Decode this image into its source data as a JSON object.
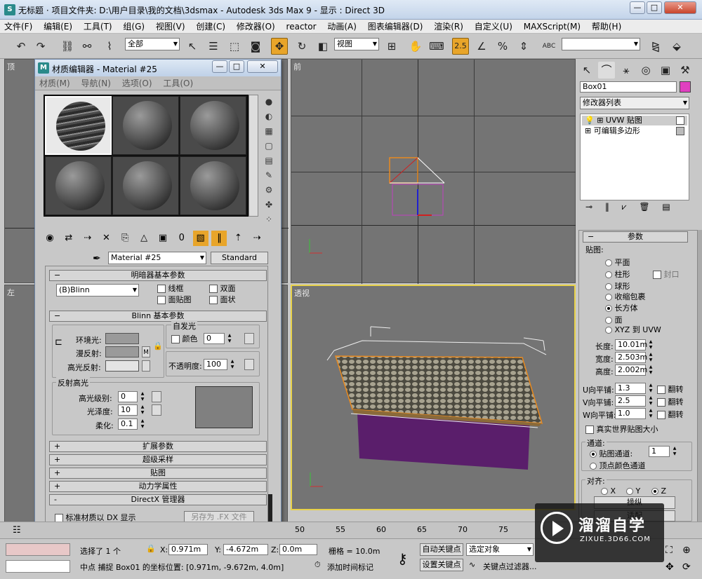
{
  "window": {
    "title": "无标题   · 项目文件夹: D:\\用户目录\\我的文档\\3dsmax    - Autodesk 3ds Max 9      - 显示 : Direct 3D",
    "minimize": "—",
    "maximize": "□",
    "close": "✕"
  },
  "menu": [
    "文件(F)",
    "编辑(E)",
    "工具(T)",
    "组(G)",
    "视图(V)",
    "创建(C)",
    "修改器(O)",
    "reactor",
    "动画(A)",
    "图表编辑器(D)",
    "渲染(R)",
    "自定义(U)",
    "MAXScript(M)",
    "帮助(H)"
  ],
  "toolbar": {
    "selection_filter": "全部",
    "ref_coord": "视图",
    "snap_value": "2.5",
    "abc_label": "ABC"
  },
  "viewports": {
    "top": "顶",
    "front": "前",
    "left": "左",
    "perspective": "透视"
  },
  "material_editor": {
    "title": "材质编辑器 - Material #25",
    "menu": [
      "材质(M)",
      "导航(N)",
      "选项(O)",
      "工具(O)"
    ],
    "material_name": "Material #25",
    "material_type": "Standard",
    "shader_rollout": {
      "title": "明暗器基本参数",
      "shader": "(B)Blinn",
      "wire": "线框",
      "two_sided": "双面",
      "face_map": "面贴图",
      "faceted": "面状"
    },
    "blinn_rollout": {
      "title": "Blinn 基本参数",
      "ambient": "环境光:",
      "diffuse": "漫反射:",
      "specular": "高光反射:",
      "self_illum": "自发光",
      "color": "颜色",
      "self_illum_value": "0",
      "opacity": "不透明度:",
      "opacity_value": "100",
      "lock_m": "M",
      "spec_highlights": "反射高光",
      "spec_level": "高光级别:",
      "spec_level_value": "0",
      "glossiness": "光泽度:",
      "glossiness_value": "10",
      "soften": "柔化:",
      "soften_value": "0.1"
    },
    "rollouts": [
      {
        "sign": "+",
        "title": "扩展参数"
      },
      {
        "sign": "+",
        "title": "超级采样"
      },
      {
        "sign": "+",
        "title": "贴图"
      },
      {
        "sign": "+",
        "title": "动力学属性"
      },
      {
        "sign": "-",
        "title": "DirectX 管理器"
      }
    ],
    "dx_checkbox": "标准材质以 DX 显示",
    "save_fx": "另存为 .FX 文件"
  },
  "command_panel": {
    "object_name": "Box01",
    "modifier_list": "修改器列表",
    "stack": [
      {
        "label": "UVW 贴图",
        "sign": "+"
      },
      {
        "label": "可编辑多边形",
        "sign": "+"
      }
    ],
    "params_title": "参数",
    "mapping_label": "贴图:",
    "mapping_types": [
      "平面",
      "柱形",
      "球形",
      "收缩包裹",
      "长方体",
      "面",
      "XYZ 到 UVW"
    ],
    "selected_mapping": "长方体",
    "cap": "封口",
    "length_label": "长度:",
    "length": "10.01m",
    "width_label": "宽度:",
    "width": "2.503m",
    "height_label": "高度:",
    "height": "2.002m",
    "u_tile_label": "U向平铺:",
    "u_tile": "1.3",
    "v_tile_label": "V向平铺:",
    "v_tile": "2.5",
    "w_tile_label": "W向平铺:",
    "w_tile": "1.0",
    "flip": "翻转",
    "real_world": "真实世界贴图大小",
    "channel_title": "通道:",
    "map_channel": "贴图通道:",
    "map_channel_value": "1",
    "vertex_color": "顶点颜色通道",
    "align_title": "对齐:",
    "axes": [
      "X",
      "Y",
      "Z"
    ],
    "selected_axis": "Z",
    "manip": "操纵",
    "fit": "适配"
  },
  "timeline": {
    "ticks": [
      "50",
      "55",
      "60",
      "65",
      "70",
      "75"
    ]
  },
  "status": {
    "selected": "选择了 1 个",
    "x_label": "X:",
    "x": "0.971m",
    "y_label": "Y:",
    "y": "-4.672m",
    "z_label": "Z:",
    "z": "0.0m",
    "grid": "栅格 = 10.0m",
    "auto_key": "自动关键点",
    "select_object": "选定对象",
    "prompt": "中点  捕捉 Box01 的坐标位置:  [0.971m, -9.672m, 4.0m]",
    "add_tag": "添加时间标记",
    "set_key": "设置关键点",
    "key_filters": "关键点过滤器..."
  },
  "watermark": {
    "title": "溜溜自学",
    "url": "ZIXUE.3D66.COM"
  },
  "colors": {
    "accent": "#e8a52a",
    "purple": "#5a1e6b",
    "viewport": "#747474"
  }
}
